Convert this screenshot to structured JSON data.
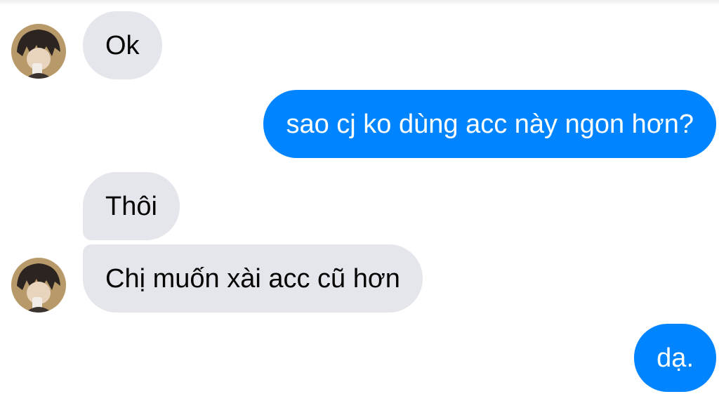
{
  "conversation": {
    "messages": [
      {
        "sender": "other",
        "text": "Ok"
      },
      {
        "sender": "self",
        "text": "sao cj ko dùng acc này ngon hơn?"
      },
      {
        "sender": "other",
        "text": "Thôi"
      },
      {
        "sender": "other",
        "text": "Chị muốn xài acc cũ hơn"
      },
      {
        "sender": "self",
        "text": "dạ."
      }
    ]
  },
  "colors": {
    "incoming_bubble": "#e4e6eb",
    "outgoing_bubble": "#0084ff",
    "background": "#ffffff"
  },
  "icons": {
    "avatar": "contact-avatar"
  }
}
